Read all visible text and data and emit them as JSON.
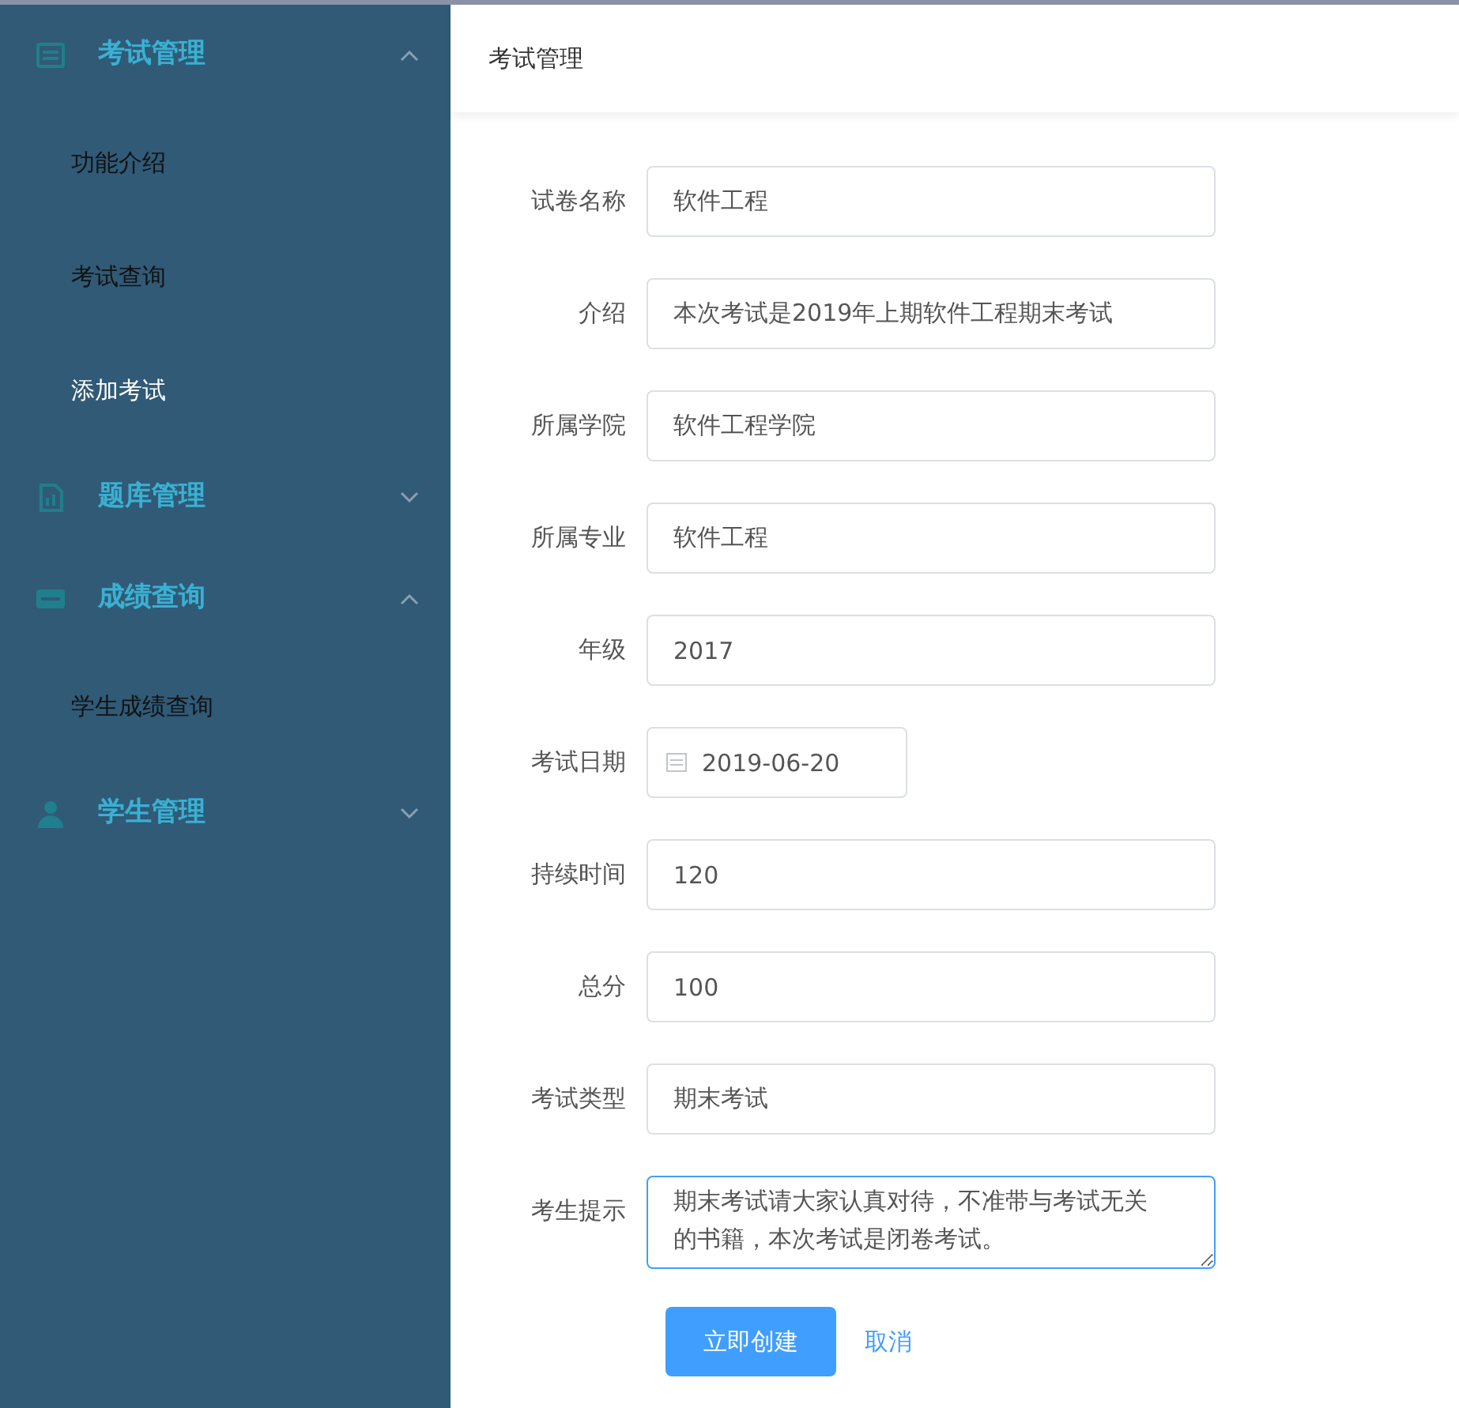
{
  "sidebar": {
    "groups": [
      {
        "title": "考试管理",
        "expanded": true,
        "items": [
          {
            "label": "功能介绍",
            "selected": false
          },
          {
            "label": "考试查询",
            "selected": false
          },
          {
            "label": "添加考试",
            "selected": true
          }
        ]
      },
      {
        "title": "题库管理",
        "expanded": false
      },
      {
        "title": "成绩查询",
        "expanded": true,
        "items": [
          {
            "label": "学生成绩查询",
            "selected": false
          }
        ]
      },
      {
        "title": "学生管理",
        "expanded": false
      }
    ]
  },
  "header": {
    "title": "考试管理"
  },
  "form": {
    "fields": [
      {
        "label": "试卷名称",
        "kind": "input",
        "value": "软件工程",
        "focused": false
      },
      {
        "label": "介绍",
        "kind": "input",
        "value": "本次考试是2019年上期软件工程期末考试",
        "focused": false
      },
      {
        "label": "所属学院",
        "kind": "input",
        "value": "软件工程学院",
        "focused": false
      },
      {
        "label": "所属专业",
        "kind": "input",
        "value": "软件工程",
        "focused": false
      },
      {
        "label": "年级",
        "kind": "input",
        "value": "2017",
        "focused": false
      },
      {
        "label": "考试日期",
        "kind": "date",
        "value": "2019-06-20",
        "focused": false
      },
      {
        "label": "持续时间",
        "kind": "input",
        "value": "120",
        "focused": false
      },
      {
        "label": "总分",
        "kind": "input",
        "value": "100",
        "focused": false
      },
      {
        "label": "考试类型",
        "kind": "input",
        "value": "期末考试",
        "focused": false
      },
      {
        "label": "考生提示",
        "kind": "textarea",
        "value": "期末考试请大家认真对待，不准带与考试无关的书籍，本次考试是闭卷考试。",
        "focused": true
      }
    ],
    "buttons": [
      {
        "label": "立即创建",
        "kind": "primary"
      },
      {
        "label": "取消",
        "kind": "text"
      }
    ]
  }
}
